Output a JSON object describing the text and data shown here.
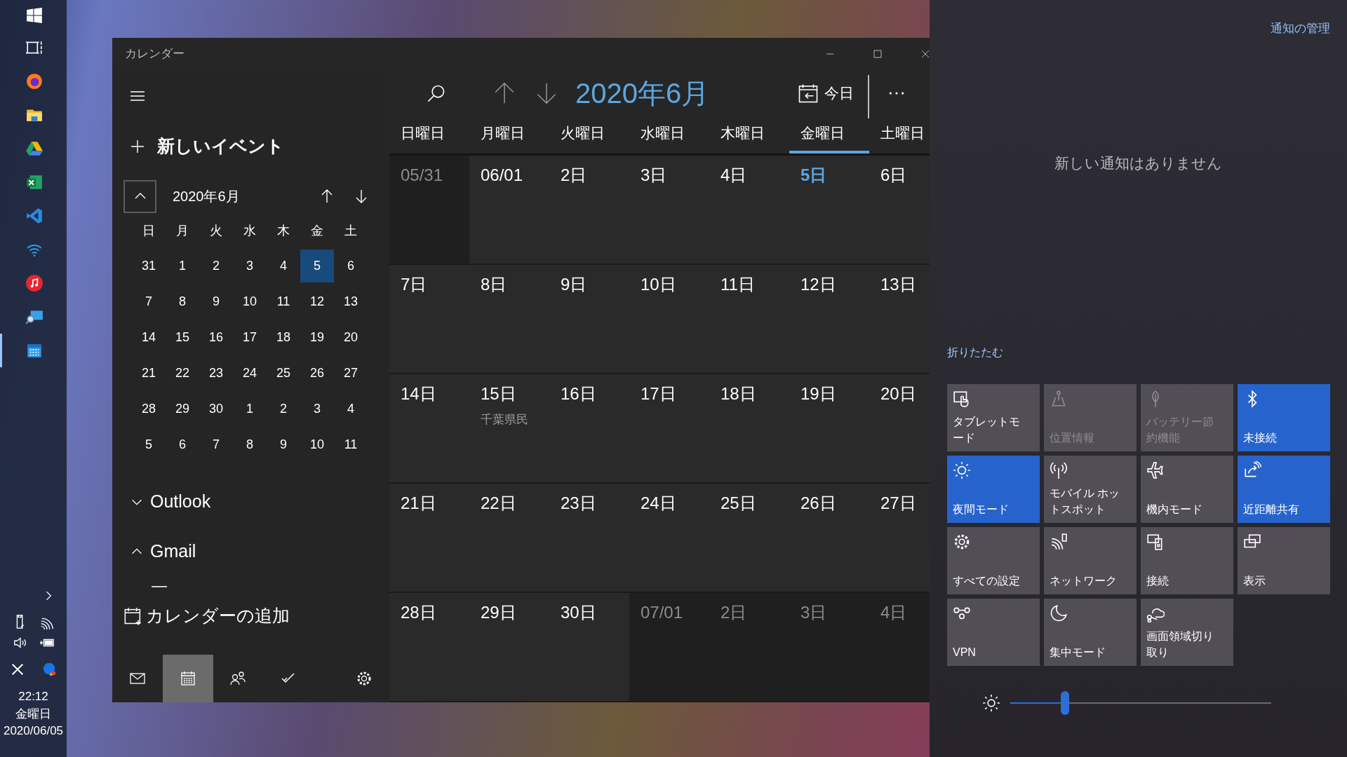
{
  "taskbar": {
    "apps": [
      {
        "kind": "start",
        "selected": false
      },
      {
        "kind": "taskview",
        "selected": false
      },
      {
        "kind": "browser",
        "selected": false
      },
      {
        "kind": "folder",
        "selected": false
      },
      {
        "kind": "drive",
        "selected": false
      },
      {
        "kind": "spreadsheet",
        "selected": false
      },
      {
        "kind": "code",
        "selected": false
      },
      {
        "kind": "wifi",
        "selected": false
      },
      {
        "kind": "music",
        "selected": false
      },
      {
        "kind": "remote",
        "selected": false
      },
      {
        "kind": "calendar",
        "selected": true
      }
    ],
    "clock": {
      "time": "22:12",
      "day": "金曜日",
      "date": "2020/06/05"
    }
  },
  "window": {
    "title": "カレンダー"
  },
  "sidebar": {
    "new_event": "新しいイベント",
    "mini_calendar": {
      "month": "2020年6月",
      "weekdays": [
        "日",
        "月",
        "火",
        "水",
        "木",
        "金",
        "土"
      ],
      "weeks": [
        [
          {
            "day": "31",
            "selected": false
          },
          {
            "day": "1",
            "selected": false
          },
          {
            "day": "2",
            "selected": false
          },
          {
            "day": "3",
            "selected": false
          },
          {
            "day": "4",
            "selected": false
          },
          {
            "day": "5",
            "selected": true
          },
          {
            "day": "6",
            "selected": false
          }
        ],
        [
          {
            "day": "7",
            "selected": false
          },
          {
            "day": "8",
            "selected": false
          },
          {
            "day": "9",
            "selected": false
          },
          {
            "day": "10",
            "selected": false
          },
          {
            "day": "11",
            "selected": false
          },
          {
            "day": "12",
            "selected": false
          },
          {
            "day": "13",
            "selected": false
          }
        ],
        [
          {
            "day": "14",
            "selected": false
          },
          {
            "day": "15",
            "selected": false
          },
          {
            "day": "16",
            "selected": false
          },
          {
            "day": "17",
            "selected": false
          },
          {
            "day": "18",
            "selected": false
          },
          {
            "day": "19",
            "selected": false
          },
          {
            "day": "20",
            "selected": false
          }
        ],
        [
          {
            "day": "21",
            "selected": false
          },
          {
            "day": "22",
            "selected": false
          },
          {
            "day": "23",
            "selected": false
          },
          {
            "day": "24",
            "selected": false
          },
          {
            "day": "25",
            "selected": false
          },
          {
            "day": "26",
            "selected": false
          },
          {
            "day": "27",
            "selected": false
          }
        ],
        [
          {
            "day": "28",
            "selected": false
          },
          {
            "day": "29",
            "selected": false
          },
          {
            "day": "30",
            "selected": false
          },
          {
            "day": "1",
            "selected": false
          },
          {
            "day": "2",
            "selected": false
          },
          {
            "day": "3",
            "selected": false
          },
          {
            "day": "4",
            "selected": false
          }
        ],
        [
          {
            "day": "5",
            "selected": false
          },
          {
            "day": "6",
            "selected": false
          },
          {
            "day": "7",
            "selected": false
          },
          {
            "day": "8",
            "selected": false
          },
          {
            "day": "9",
            "selected": false
          },
          {
            "day": "10",
            "selected": false
          },
          {
            "day": "11",
            "selected": false
          }
        ]
      ]
    },
    "accounts": [
      {
        "name": "Outlook",
        "expanded": false
      },
      {
        "name": "Gmail",
        "expanded": true
      }
    ],
    "add_calendar": "カレンダーの追加",
    "nav": [
      {
        "kind": "mail",
        "selected": false
      },
      {
        "kind": "calendar",
        "selected": true
      },
      {
        "kind": "people",
        "selected": false
      },
      {
        "kind": "todo",
        "selected": false
      },
      {
        "kind": "settings",
        "selected": false
      }
    ]
  },
  "main": {
    "month_title": "2020年6月",
    "today_button": "今日",
    "weekdays": [
      {
        "label": "日曜日",
        "today": false
      },
      {
        "label": "月曜日",
        "today": false
      },
      {
        "label": "火曜日",
        "today": false
      },
      {
        "label": "水曜日",
        "today": false
      },
      {
        "label": "木曜日",
        "today": false
      },
      {
        "label": "金曜日",
        "today": true
      },
      {
        "label": "土曜日",
        "today": false
      }
    ],
    "weeks": [
      [
        {
          "date": "05/31",
          "in_month": false,
          "today": false
        },
        {
          "date": "06/01",
          "in_month": true,
          "today": false
        },
        {
          "date": "2日",
          "in_month": true,
          "today": false
        },
        {
          "date": "3日",
          "in_month": true,
          "today": false
        },
        {
          "date": "4日",
          "in_month": true,
          "today": false
        },
        {
          "date": "5日",
          "in_month": true,
          "today": true
        },
        {
          "date": "6日",
          "in_month": true,
          "today": false
        }
      ],
      [
        {
          "date": "7日",
          "in_month": true,
          "today": false
        },
        {
          "date": "8日",
          "in_month": true,
          "today": false
        },
        {
          "date": "9日",
          "in_month": true,
          "today": false
        },
        {
          "date": "10日",
          "in_month": true,
          "today": false
        },
        {
          "date": "11日",
          "in_month": true,
          "today": false
        },
        {
          "date": "12日",
          "in_month": true,
          "today": false
        },
        {
          "date": "13日",
          "in_month": true,
          "today": false
        }
      ],
      [
        {
          "date": "14日",
          "in_month": true,
          "today": false
        },
        {
          "date": "15日",
          "in_month": true,
          "today": false,
          "events": [
            "千葉県民"
          ]
        },
        {
          "date": "16日",
          "in_month": true,
          "today": false
        },
        {
          "date": "17日",
          "in_month": true,
          "today": false
        },
        {
          "date": "18日",
          "in_month": true,
          "today": false
        },
        {
          "date": "19日",
          "in_month": true,
          "today": false
        },
        {
          "date": "20日",
          "in_month": true,
          "today": false
        }
      ],
      [
        {
          "date": "21日",
          "in_month": true,
          "today": false
        },
        {
          "date": "22日",
          "in_month": true,
          "today": false
        },
        {
          "date": "23日",
          "in_month": true,
          "today": false
        },
        {
          "date": "24日",
          "in_month": true,
          "today": false
        },
        {
          "date": "25日",
          "in_month": true,
          "today": false
        },
        {
          "date": "26日",
          "in_month": true,
          "today": false
        },
        {
          "date": "27日",
          "in_month": true,
          "today": false
        }
      ],
      [
        {
          "date": "28日",
          "in_month": true,
          "today": false
        },
        {
          "date": "29日",
          "in_month": true,
          "today": false
        },
        {
          "date": "30日",
          "in_month": true,
          "today": false
        },
        {
          "date": "07/01",
          "in_month": false,
          "today": false
        },
        {
          "date": "2日",
          "in_month": false,
          "today": false
        },
        {
          "date": "3日",
          "in_month": false,
          "today": false
        },
        {
          "date": "4日",
          "in_month": false,
          "today": false
        }
      ]
    ]
  },
  "action_center": {
    "manage": "通知の管理",
    "empty_message": "新しい通知はありません",
    "collapse": "折りたたむ",
    "tiles": [
      {
        "kind": "tablet",
        "label": "タブレットモード",
        "on": false,
        "disabled": false
      },
      {
        "kind": "location",
        "label": "位置情報",
        "on": false,
        "disabled": true
      },
      {
        "kind": "battery_saver",
        "label": "バッテリー節約機能",
        "on": false,
        "disabled": true
      },
      {
        "kind": "bluetooth",
        "label": "未接続",
        "on": true,
        "disabled": false
      },
      {
        "kind": "night_light",
        "label": "夜間モード",
        "on": true,
        "disabled": false
      },
      {
        "kind": "hotspot",
        "label": "モバイル ホットスポット",
        "on": false,
        "disabled": false
      },
      {
        "kind": "airplane",
        "label": "機内モード",
        "on": false,
        "disabled": false
      },
      {
        "kind": "nearby_share",
        "label": "近距離共有",
        "on": true,
        "disabled": false
      },
      {
        "kind": "settings",
        "label": "すべての設定",
        "on": false,
        "disabled": false
      },
      {
        "kind": "network",
        "label": "ネットワーク",
        "on": false,
        "disabled": false
      },
      {
        "kind": "connect",
        "label": "接続",
        "on": false,
        "disabled": false
      },
      {
        "kind": "display",
        "label": "表示",
        "on": false,
        "disabled": false
      },
      {
        "kind": "vpn",
        "label": "VPN",
        "on": false,
        "disabled": false
      },
      {
        "kind": "focus",
        "label": "集中モード",
        "on": false,
        "disabled": false
      },
      {
        "kind": "snip",
        "label": "画面領域切り取り",
        "on": false,
        "disabled": false
      }
    ],
    "brightness": {
      "level": 0.21
    }
  }
}
